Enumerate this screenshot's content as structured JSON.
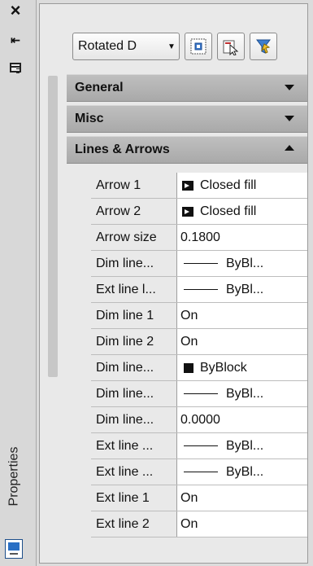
{
  "titlebar": {
    "vertical_title": "Properties",
    "icons": [
      "close-icon",
      "auto-hide-icon",
      "menu-icon",
      "properties-icon"
    ],
    "close_glyph": "×",
    "autohide_glyph": "⇤"
  },
  "toolbar": {
    "object_select_value": "Rotated D",
    "buttons": [
      "toggle-pickadd-icon",
      "select-objects-icon",
      "quick-select-icon"
    ]
  },
  "sections": [
    {
      "label": "General",
      "state": "collapsed"
    },
    {
      "label": "Misc",
      "state": "collapsed"
    },
    {
      "label": "Lines & Arrows",
      "state": "expanded"
    }
  ],
  "properties": [
    {
      "name": "Arrow 1",
      "value": "Closed fill",
      "swatch": "arrow"
    },
    {
      "name": "Arrow 2",
      "value": "Closed fill",
      "swatch": "arrow"
    },
    {
      "name": "Arrow size",
      "value": "0.1800",
      "swatch": "none"
    },
    {
      "name": "Dim line...",
      "value": "ByBl...",
      "swatch": "line"
    },
    {
      "name": "Ext line l...",
      "value": "ByBl...",
      "swatch": "line"
    },
    {
      "name": "Dim line 1",
      "value": "On",
      "swatch": "none"
    },
    {
      "name": "Dim line 2",
      "value": "On",
      "swatch": "none"
    },
    {
      "name": "Dim line...",
      "value": "ByBlock",
      "swatch": "square"
    },
    {
      "name": "Dim line...",
      "value": "ByBl...",
      "swatch": "line"
    },
    {
      "name": "Dim line...",
      "value": "0.0000",
      "swatch": "none"
    },
    {
      "name": "Ext line ...",
      "value": "ByBl...",
      "swatch": "line"
    },
    {
      "name": "Ext line ...",
      "value": "ByBl...",
      "swatch": "line"
    },
    {
      "name": "Ext line 1",
      "value": "On",
      "swatch": "none"
    },
    {
      "name": "Ext line 2",
      "value": "On",
      "swatch": "none"
    }
  ]
}
